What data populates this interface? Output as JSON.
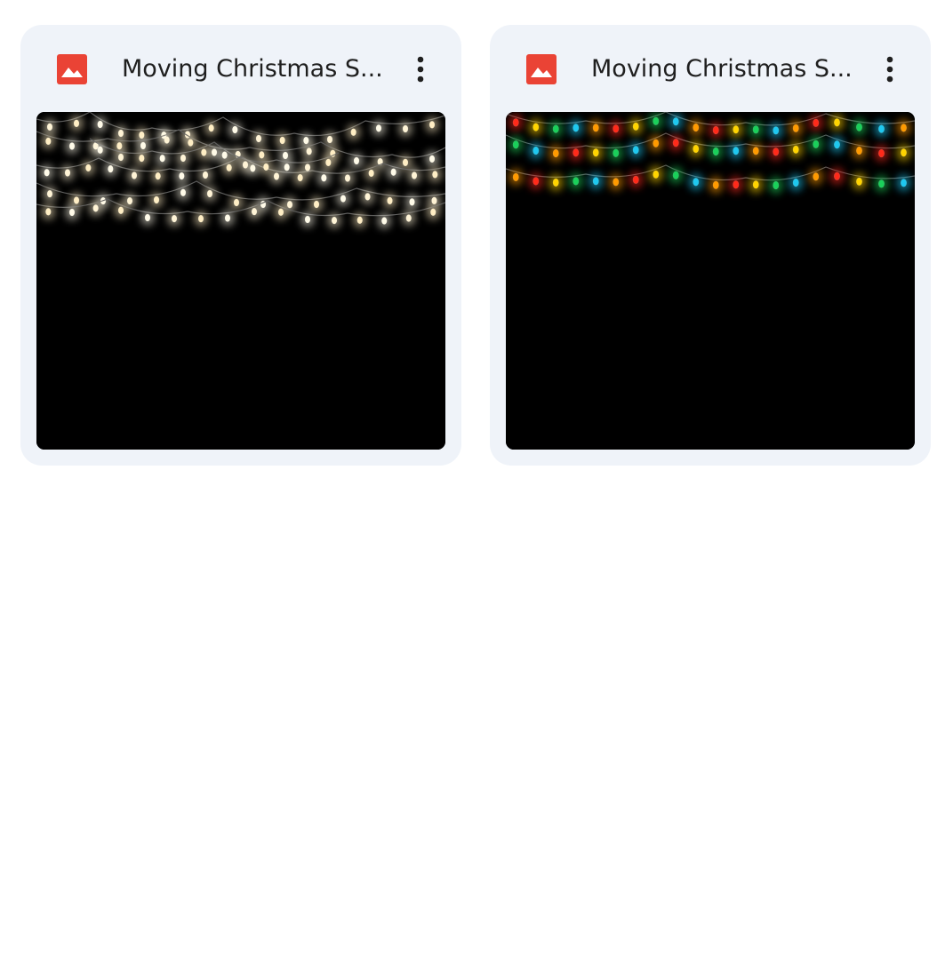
{
  "files": [
    {
      "name": "Moving Christmas S...",
      "icon": "image-file-icon",
      "icon_color": "#ea4335",
      "menu_icon": "more-vert-icon",
      "thumbnail": {
        "description_theme": "warm-white-string-lights",
        "bulb_colors": [
          "#fff4d6",
          "#ffeec4",
          "#fffbe9"
        ]
      }
    },
    {
      "name": "Moving Christmas S...",
      "icon": "image-file-icon",
      "icon_color": "#ea4335",
      "menu_icon": "more-vert-icon",
      "thumbnail": {
        "description_theme": "multicolor-string-lights",
        "bulb_colors": [
          "#ff2a1a",
          "#ffd400",
          "#1ad05a",
          "#1ec8f0",
          "#ff9a00"
        ]
      }
    }
  ],
  "colors": {
    "card_background": "#eff3f9",
    "text": "#1f1f1f",
    "page_background": "#ffffff"
  }
}
